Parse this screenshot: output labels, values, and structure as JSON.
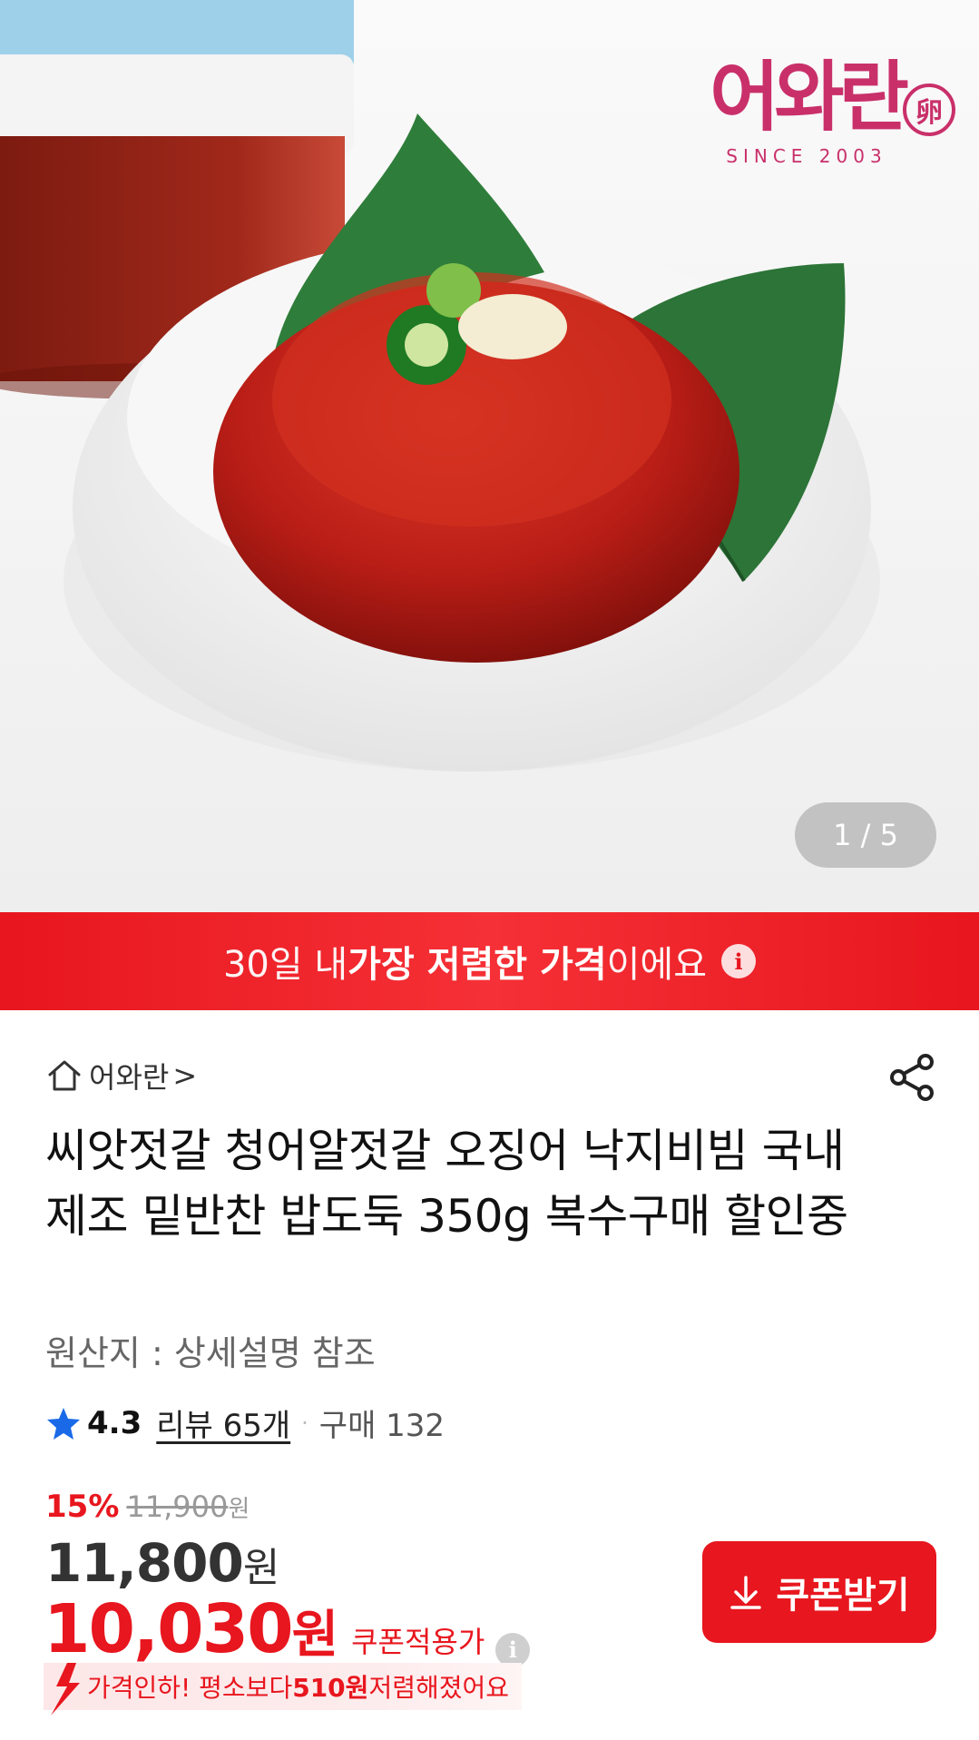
{
  "product_image": {
    "brand_logo_text": "어와란",
    "brand_egg_char": "卵",
    "brand_since": "SINCE 2003",
    "counter": "1 / 5"
  },
  "lowest_banner": {
    "prefix": "30일 내 ",
    "highlight": "가장 저렴한 가격",
    "suffix": "이에요",
    "info": "i"
  },
  "store": {
    "name": "어와란",
    "chevron": ">"
  },
  "product": {
    "title": "씨앗젓갈 청어알젓갈 오징어 낙지비빔 국내제조 밑반찬 밥도둑 350g 복수구매 할인중",
    "origin": "원산지 : 상세설명 참조"
  },
  "rating": {
    "score": "4.3",
    "review": "리뷰 65개",
    "separator": "·",
    "purchase": "구매 132"
  },
  "price": {
    "discount_rate": "15%",
    "original": "11,900",
    "original_unit": "원",
    "sale": "11,800",
    "sale_unit": "원",
    "coupon_price": "10,030",
    "coupon_unit": "원",
    "coupon_label": "쿠폰적용가",
    "coupon_info": "i"
  },
  "drop_notice": {
    "prefix": "가격인하! 평소보다 ",
    "amount": "510원",
    "suffix": " 저렴해졌어요"
  },
  "coupon_button": {
    "label": "쿠폰받기"
  },
  "colors": {
    "accent_red": "#e8161e",
    "brand_pink": "#c9306a",
    "star_blue": "#1a6ae8"
  }
}
